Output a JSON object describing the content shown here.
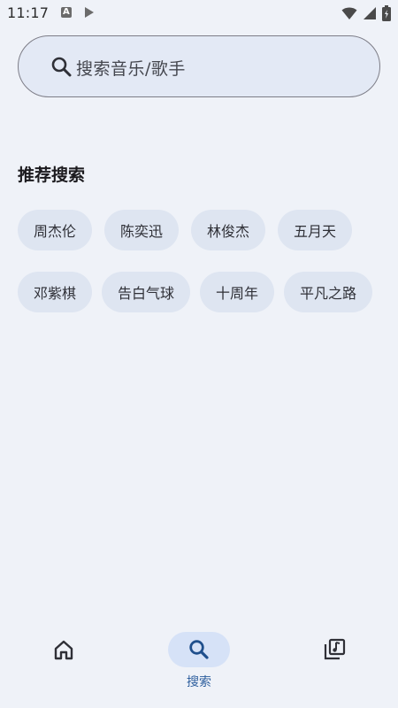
{
  "status_bar": {
    "time": "11:17",
    "icons": [
      "app-notification-icon",
      "play-notification-icon",
      "wifi-icon",
      "cellular-signal-icon",
      "battery-icon"
    ]
  },
  "search": {
    "placeholder": "搜索音乐/歌手",
    "icon": "search-icon"
  },
  "recommended": {
    "title": "推荐搜索",
    "row1": [
      "周杰伦",
      "陈奕迅",
      "林俊杰",
      "五月天"
    ],
    "row2": [
      "邓紫棋",
      "告白气球",
      "十周年",
      "平凡之路"
    ]
  },
  "bottom_nav": {
    "items": [
      {
        "icon": "home-icon",
        "label": "",
        "active": false
      },
      {
        "icon": "search-icon",
        "label": "搜索",
        "active": true
      },
      {
        "icon": "music-library-icon",
        "label": "",
        "active": false
      }
    ]
  },
  "colors": {
    "background": "#eff2f8",
    "search_bar_bg": "#e3e9f5",
    "chip_bg": "#dee5f1",
    "active_nav_pill": "#d6e2f7",
    "active_label": "#2e5f9e"
  }
}
